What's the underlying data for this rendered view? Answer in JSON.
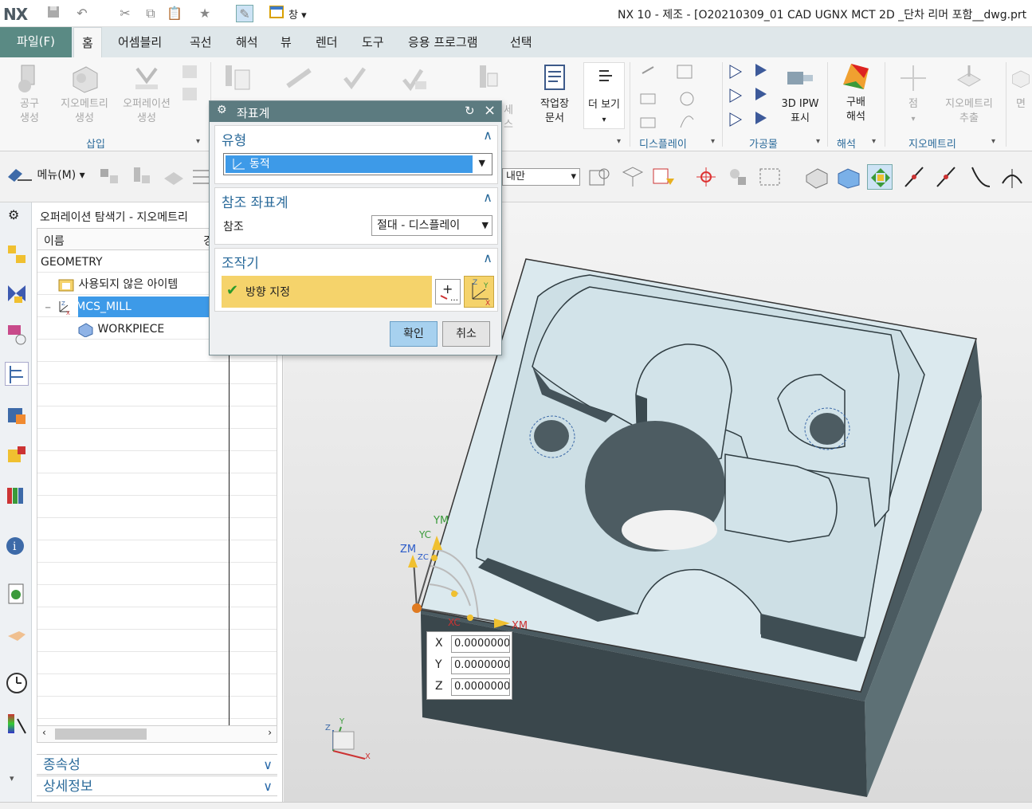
{
  "app": {
    "logo": "NX",
    "window_title": "NX 10 - 제조 - [O20210309_01 CAD UGNX MCT 2D _단차 리머 포함__dwg.prt",
    "window_menu_label": "창"
  },
  "menu_tabs": {
    "file": "파일(F)",
    "tabs": [
      "홈",
      "어셈블리",
      "곡선",
      "해석",
      "뷰",
      "렌더",
      "도구",
      "응용 프로그램",
      "선택"
    ]
  },
  "ribbon": {
    "insert_buttons": [
      "공구\n생성",
      "지오메트리\n생성",
      "오퍼레이션\n생성"
    ],
    "insert_group": "삽입",
    "hidden_tail": "세스",
    "shop_doc": "작업장\n문서",
    "more": "더 보기",
    "display_group": "디스플레이",
    "ipw": "3D IPW\n표시",
    "workpiece_group": "가공물",
    "gradient": "구배\n해석",
    "analysis_group": "해석",
    "point": "점",
    "extract_geometry": "지오메트리\n추출",
    "geometry_group": "지오메트리",
    "face": "면"
  },
  "toolbar2": {
    "menu": "메뉴(M)",
    "filter_value": "내만"
  },
  "navigator": {
    "title": "오퍼레이션 탐색기 - 지오메트리",
    "col_name": "이름",
    "col_2": "경",
    "rows": [
      "GEOMETRY",
      "사용되지 않은 아이템",
      "MCS_MILL",
      "WORKPIECE"
    ],
    "panel_dependencies": "종속성",
    "panel_details": "상세정보"
  },
  "dialog": {
    "title": "좌표계",
    "section_type": "유형",
    "type_value": "동적",
    "section_reference": "참조 좌표계",
    "reference_label": "참조",
    "reference_value": "절대 - 디스플레이",
    "section_manipulator": "조작기",
    "specify_orientation": "방향 지정",
    "ok": "확인",
    "cancel": "취소"
  },
  "coord_input": {
    "x_label": "X",
    "x_value": "0.0000000",
    "y_label": "Y",
    "y_value": "0.0000000",
    "z_label": "Z",
    "z_value": "0.0000000"
  },
  "triad_labels": {
    "ym": "YM",
    "yc": "YC",
    "zm": "ZM",
    "zc": "ZC",
    "xc": "XC",
    "xm": "XM",
    "ym2": "YM"
  },
  "view_triad": {
    "x": "X",
    "y": "Y",
    "z": "Z"
  },
  "colors": {
    "file_tab": "#5a8a84",
    "dialog_title": "#5c7b80",
    "selection": "#3d9ae8",
    "orientation_highlight": "#f5d36b",
    "part_face": "#d9e8ec",
    "part_side": "#3b4b52"
  }
}
